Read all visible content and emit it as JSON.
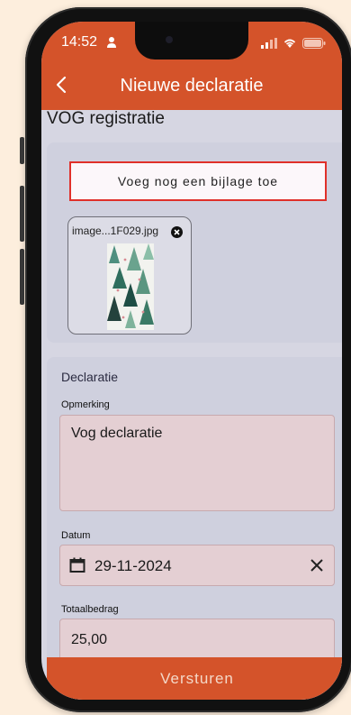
{
  "status_bar": {
    "time": "14:52"
  },
  "appbar": {
    "title": "Nieuwe declaratie"
  },
  "page": {
    "heading": "VOG registratie"
  },
  "attachments": {
    "add_button_label": "Voeg nog een bijlage toe",
    "files": [
      {
        "name": "image...1F029.jpg"
      }
    ]
  },
  "form": {
    "section_title": "Declaratie",
    "remark": {
      "label": "Opmerking",
      "value": "Vog declaratie"
    },
    "date": {
      "label": "Datum",
      "value": "29-11-2024"
    },
    "amount": {
      "label": "Totaalbedrag",
      "value": "25,00"
    }
  },
  "submit_label": "Versturen",
  "colors": {
    "accent": "#d4532a",
    "background": "#fdeedd",
    "highlight": "#e0302a"
  }
}
